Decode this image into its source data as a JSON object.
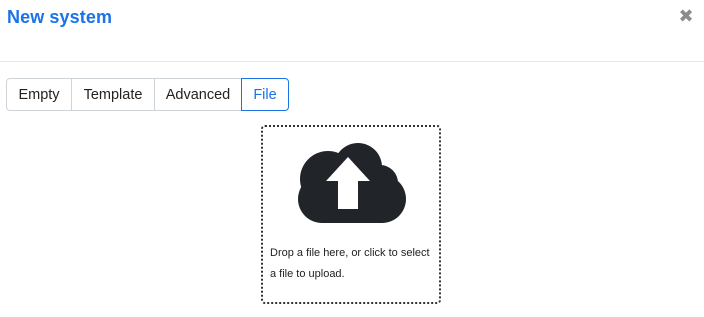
{
  "dialog": {
    "title": "New system",
    "close_icon": "close-icon"
  },
  "tabs": [
    {
      "label": "Empty",
      "active": false
    },
    {
      "label": "Template",
      "active": false
    },
    {
      "label": "Advanced",
      "active": false
    },
    {
      "label": "File",
      "active": true
    }
  ],
  "upload": {
    "icon": "cloud-upload-icon",
    "text": "Drop a file here, or click to select a file to upload."
  },
  "colors": {
    "accent": "#1a73e8",
    "icon": "#212529",
    "close": "#8c8c8c"
  }
}
